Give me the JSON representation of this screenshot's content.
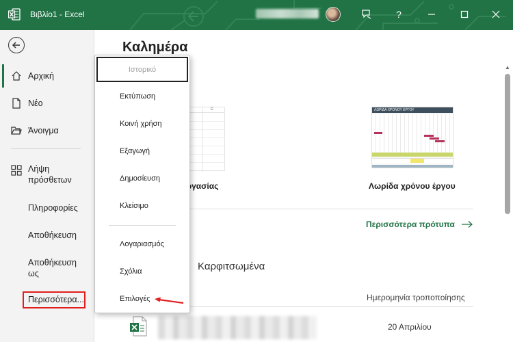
{
  "window": {
    "title": "Βιβλίο1  -  Excel",
    "help_label": "?"
  },
  "nav": {
    "items": [
      {
        "label": "Αρχική",
        "icon": "home-icon",
        "active": true
      },
      {
        "label": "Νέο",
        "icon": "new-document-icon"
      },
      {
        "label": "Άνοιγμα",
        "icon": "open-folder-icon"
      },
      {
        "label": "Λήψη πρόσθετων",
        "icon": "addins-grid-icon"
      },
      {
        "label": "Πληροφορίες"
      },
      {
        "label": "Αποθήκευση"
      },
      {
        "label": "Αποθήκευση ως"
      },
      {
        "label": "Περισσότερα..."
      }
    ]
  },
  "main": {
    "greeting": "Καλημέρα",
    "templates": [
      {
        "label": "εργασίας"
      },
      {
        "label": "Λωρίδα χρόνου έργου",
        "thumb_title": "ΛΩΡΙΔΑ ΧΡΟΝΟΥ ΕΡΓΟΥ"
      }
    ],
    "grid_headers": [
      "B",
      "C"
    ],
    "more_templates": "Περισσότερα πρότυπα",
    "pinned": "Καρφιτσωμένα",
    "date_header": "Ημερομηνία τροποποίησης",
    "file_date": "20 Απριλίου"
  },
  "menu": {
    "items": [
      {
        "label": "Ιστορικό",
        "disabled": true
      },
      {
        "label": "Εκτύπωση"
      },
      {
        "label": "Κοινή χρήση"
      },
      {
        "label": "Εξαγωγή"
      },
      {
        "label": "Δημοσίευση"
      },
      {
        "label": "Κλείσιμο"
      },
      {
        "label": "Λογαριασμός"
      },
      {
        "label": "Σχόλια"
      },
      {
        "label": "Επιλογές"
      }
    ]
  },
  "colors": {
    "brand": "#217346",
    "highlight": "#e01e1e"
  }
}
